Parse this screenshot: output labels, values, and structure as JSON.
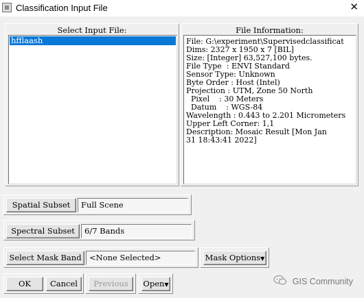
{
  "window": {
    "title": "Classification Input File"
  },
  "input_panel": {
    "label": "Select Input File:",
    "files": [
      "hfflaash"
    ]
  },
  "info_panel": {
    "label": "File Information:",
    "lines": [
      "File: G:\\experiment\\Supervisedclassificat",
      "Dims: 2327 x 1950 x 7 [BIL]",
      "Size: [Integer] 63,527,100 bytes.",
      "File Type  : ENVI Standard",
      "Sensor Type: Unknown",
      "Byte Order : Host (Intel)",
      "Projection : UTM, Zone 50 North",
      "  Pixel    : 30 Meters",
      "  Datum    : WGS-84",
      "Wavelength : 0.443 to 2.201 Micrometers",
      "Upper Left Corner: 1,1",
      "Description: Mosaic Result [Mon Jan",
      "31 18:43:41 2022]"
    ]
  },
  "spatial_subset": {
    "button": "Spatial Subset",
    "value": "Full Scene"
  },
  "spectral_subset": {
    "button": "Spectral Subset",
    "value": "6/7 Bands"
  },
  "mask": {
    "button": "Select Mask Band",
    "value": "<None Selected>",
    "options": "Mask Options"
  },
  "footer": {
    "ok": "OK",
    "cancel": "Cancel",
    "previous": "Previous",
    "open": "Open"
  },
  "watermark": "GIS Community"
}
